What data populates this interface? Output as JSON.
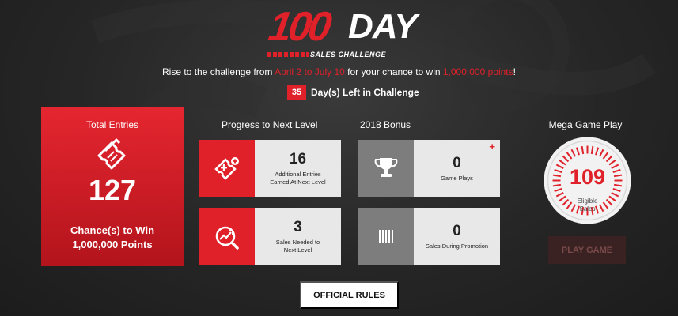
{
  "logo": {
    "number": "100",
    "word": "DAY",
    "subtitle": "SALES CHALLENGE"
  },
  "tagline": {
    "before": "Rise to the challenge from ",
    "dates": "April 2 to July 10",
    "middle": "  for your chance to win ",
    "prize": "1,000,000 points",
    "after": "!"
  },
  "days_left": {
    "count": "35",
    "label": "Day(s) Left in Challenge"
  },
  "total_entries": {
    "title": "Total Entries",
    "value": "127",
    "line1": "Chance(s) to Win",
    "line2": "1,000,000 Points",
    "icon": "ticket-icon"
  },
  "progress": {
    "heading": "Progress to Next Level",
    "cards": [
      {
        "value": "16",
        "label_1": "Additional Entries",
        "label_2": "Earned At Next Level",
        "icon": "ticket-plus-icon"
      },
      {
        "value": "3",
        "label_1": "Sales Needed to",
        "label_2": "Next Level",
        "icon": "trend-search-icon"
      }
    ]
  },
  "bonus": {
    "heading": "2018 Bonus",
    "cards": [
      {
        "value": "0",
        "label": "Game Plays",
        "icon": "trophy-icon",
        "badge": "+"
      },
      {
        "value": "0",
        "label": "Sales During Promotion",
        "icon": "barcode-icon"
      }
    ]
  },
  "mega": {
    "heading": "Mega Game Play",
    "value": "109",
    "label_1": "Eligible",
    "label_2": "Sales",
    "button": "PLAY GAME"
  },
  "rules_button": "OFFICIAL RULES",
  "colors": {
    "accent": "#e0212a",
    "background": "#262626",
    "card": "#e8e8e8",
    "grey_icon": "#7d7d7d"
  }
}
